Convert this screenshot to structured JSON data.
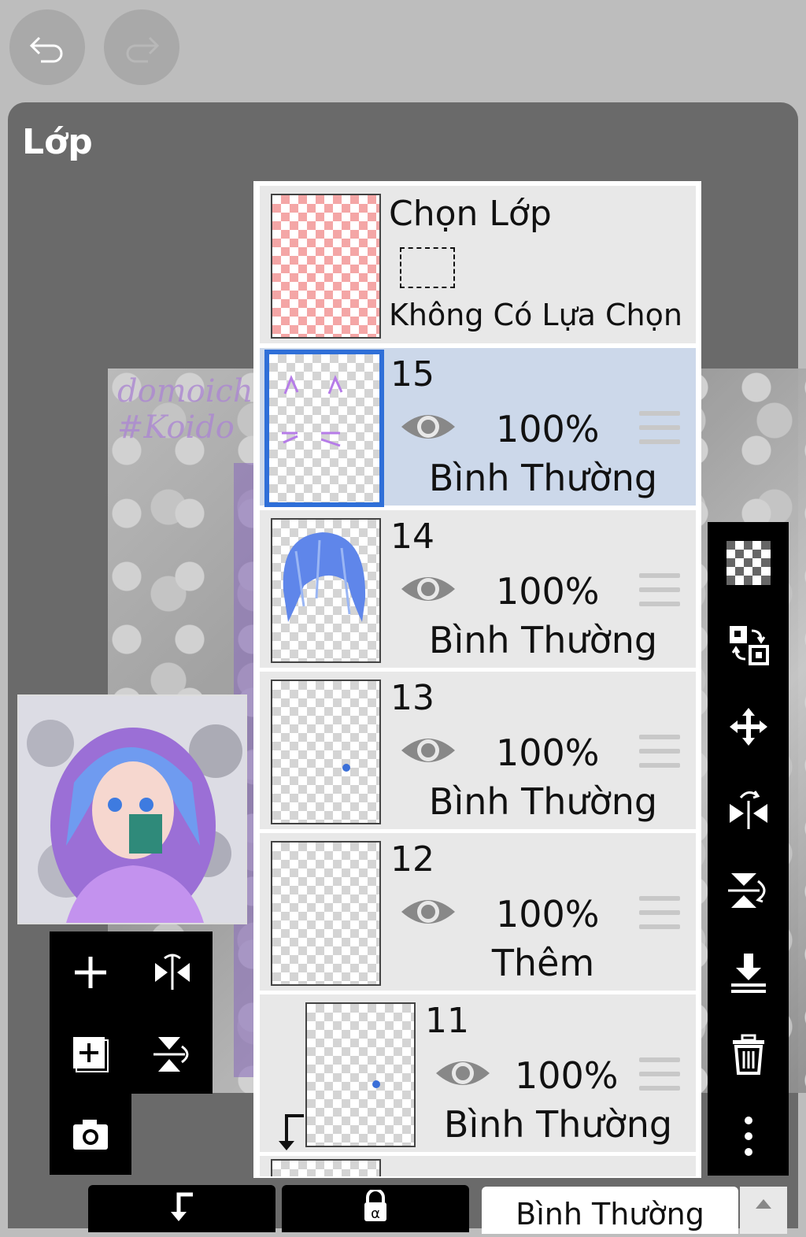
{
  "panel_title": "Lớp",
  "toolbar": {
    "undo_icon": "undo-icon",
    "redo_icon": "redo-icon"
  },
  "selection": {
    "title": "Chọn Lớp",
    "status": "Không Có Lựa Chọn"
  },
  "layers": [
    {
      "number": "15",
      "opacity": "100%",
      "blend": "Bình Thường",
      "selected": true
    },
    {
      "number": "14",
      "opacity": "100%",
      "blend": "Bình Thường",
      "selected": false
    },
    {
      "number": "13",
      "opacity": "100%",
      "blend": "Bình Thường",
      "selected": false
    },
    {
      "number": "12",
      "opacity": "100%",
      "blend": "Thêm",
      "selected": false
    },
    {
      "number": "11",
      "opacity": "100%",
      "blend": "Bình Thường",
      "selected": false,
      "clipped": true
    }
  ],
  "canvas": {
    "watermark_line1": "domoichi",
    "watermark_line2": "#Koido"
  },
  "bottom": {
    "blend_mode": "Bình Thường"
  },
  "colors": {
    "selected_row": "#ccd8ea",
    "selected_border": "#2f6fd8",
    "panel": "#6a6a6a"
  }
}
